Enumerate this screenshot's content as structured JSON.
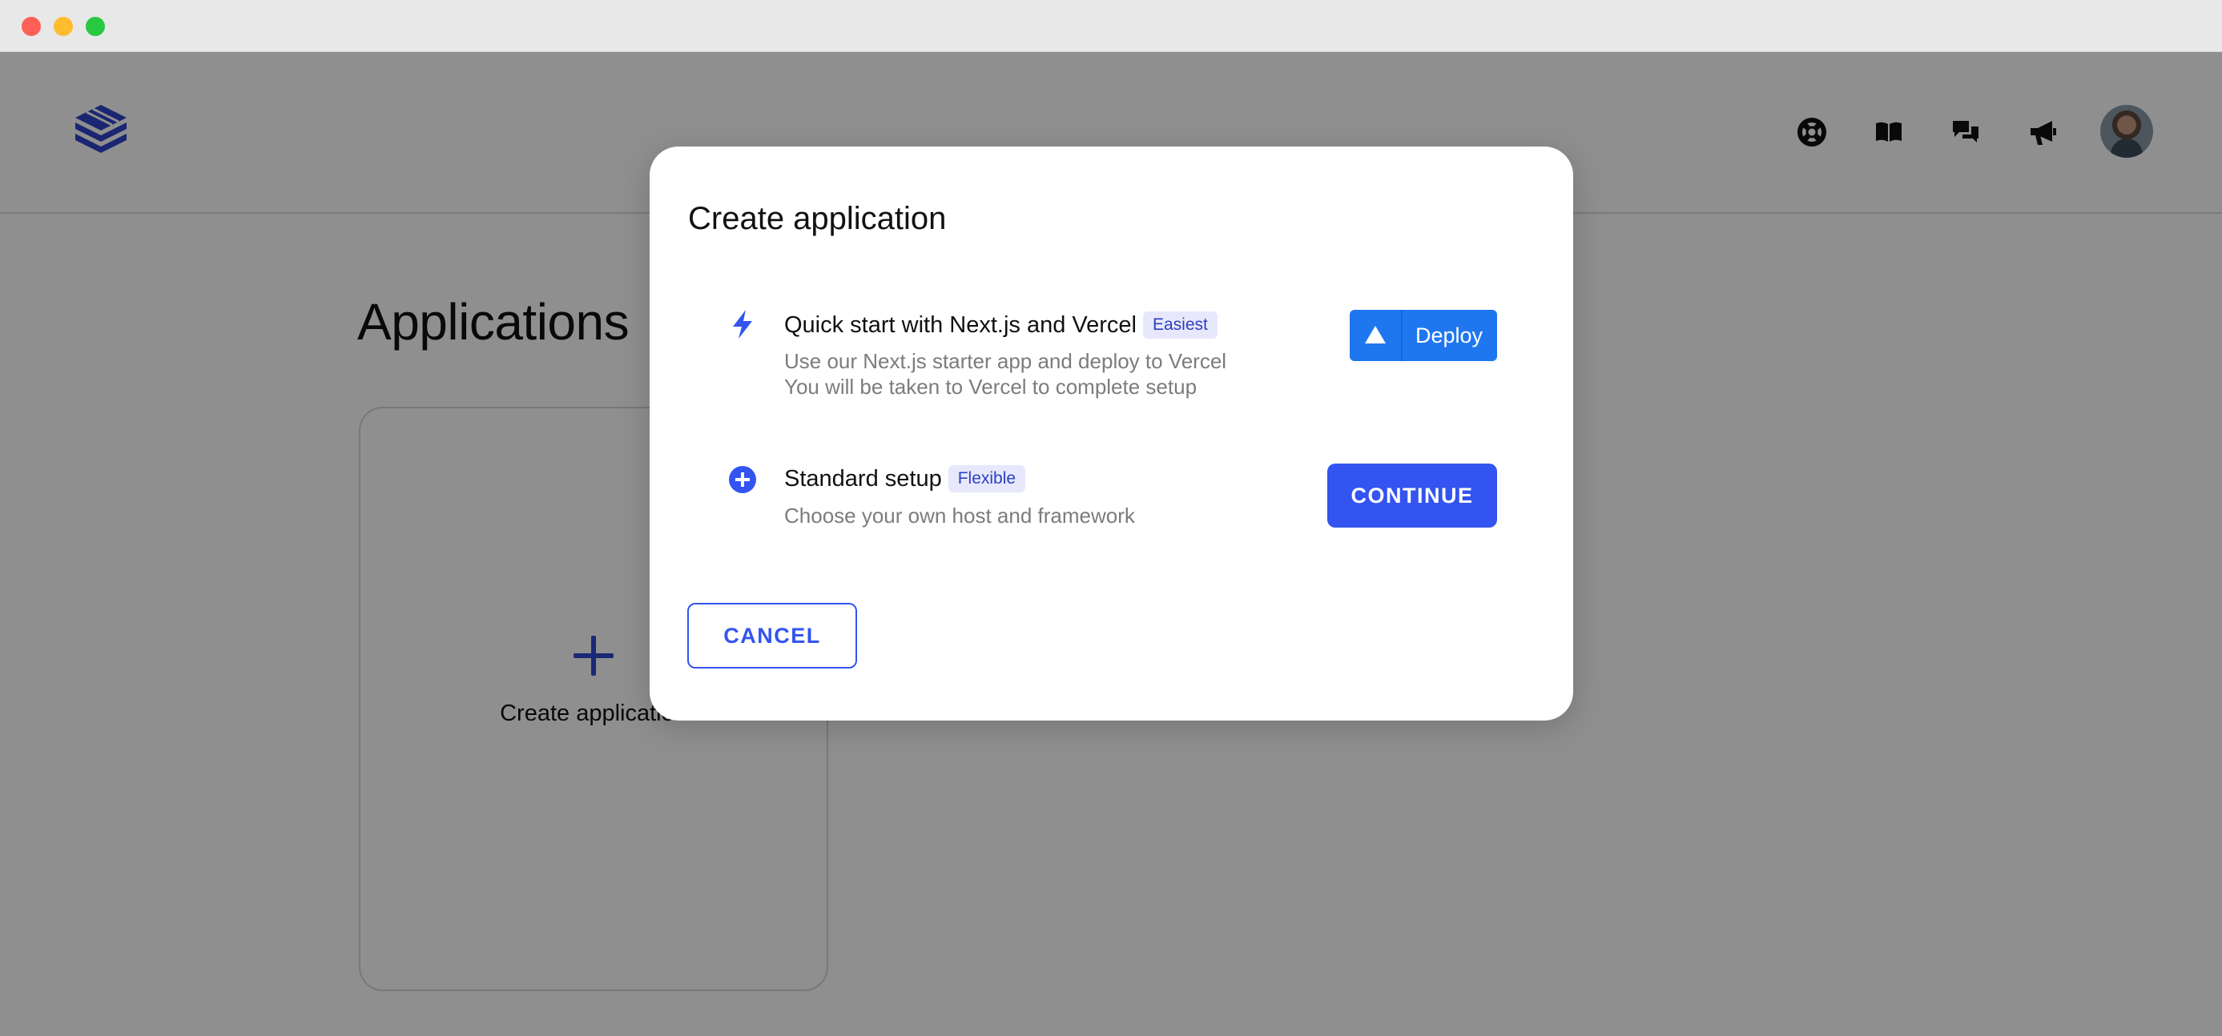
{
  "window": {
    "controls": [
      "close",
      "minimize",
      "maximize"
    ]
  },
  "header": {
    "logo_icon": "stacked-layers-logo-icon",
    "icons": [
      "support-lifebuoy-icon",
      "docs-book-icon",
      "chat-bubbles-icon",
      "announcements-megaphone-icon"
    ],
    "avatar": "user-avatar"
  },
  "main": {
    "title": "Applications",
    "create_card": {
      "icon": "plus-icon",
      "label": "Create application"
    }
  },
  "modal": {
    "title": "Create application",
    "options": [
      {
        "icon": "lightning-bolt-icon",
        "title": "Quick start with Next.js and Vercel",
        "badge": "Easiest",
        "description_line1": "Use our Next.js starter app and deploy to Vercel",
        "description_line2": "You will be taken to Vercel to complete setup",
        "action_label": "Deploy",
        "action_icon": "vercel-triangle-icon"
      },
      {
        "icon": "plus-circle-icon",
        "title": "Standard setup",
        "badge": "Flexible",
        "description_line1": "Choose your own host and framework",
        "action_label": "CONTINUE"
      }
    ],
    "cancel_label": "CANCEL"
  },
  "colors": {
    "accent": "#3354f0",
    "vercel_button": "#1f77f0",
    "badge_bg": "#e7e8fb",
    "badge_text": "#2d3fc0",
    "overlay": "rgba(0,0,0,0.44)"
  }
}
